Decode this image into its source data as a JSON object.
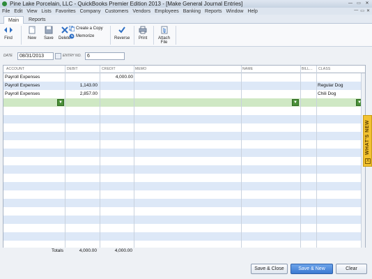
{
  "window": {
    "title": "Pine Lake Porcelain, LLC  - QuickBooks Premier Edition 2013 - [Make General Journal Entries]",
    "controls": [
      "—",
      "▭",
      "✕"
    ]
  },
  "menu": {
    "items": [
      "File",
      "Edit",
      "View",
      "Lists",
      "Favorites",
      "Company",
      "Customers",
      "Vendors",
      "Employees",
      "Banking",
      "Reports",
      "Window",
      "Help"
    ],
    "controls": [
      "—",
      "▭",
      "✕"
    ]
  },
  "tabs": [
    {
      "label": "Main",
      "active": true
    },
    {
      "label": "Reports",
      "active": false
    }
  ],
  "toolbar": {
    "find": "Find",
    "new": "New",
    "save": "Save",
    "delete": "Delete",
    "create_copy": "Create a Copy",
    "memorize": "Memorize",
    "reverse": "Reverse",
    "print": "Print",
    "attach_file_line1": "Attach",
    "attach_file_line2": "File"
  },
  "fields": {
    "date_label": "DATE",
    "date_value": "08/31/2013",
    "entry_no_label": "ENTRY NO.",
    "entry_no_value": "6"
  },
  "grid": {
    "headers": {
      "account": "ACCOUNT",
      "debit": "DEBIT",
      "credit": "CREDIT",
      "memo": "MEMO",
      "name": "NAME",
      "billable": "BILL...",
      "class": "CLASS"
    },
    "rows": [
      {
        "account": "Payroll Expenses",
        "debit": "",
        "credit": "4,000.00",
        "memo": "",
        "name": "",
        "class": ""
      },
      {
        "account": "Payroll Expenses",
        "debit": "1,143.00",
        "credit": "",
        "memo": "",
        "name": "",
        "class": "Regular Dog"
      },
      {
        "account": "Payroll Expenses",
        "debit": "2,857.00",
        "credit": "",
        "memo": "",
        "name": "",
        "class": "Chili Dog"
      }
    ]
  },
  "totals": {
    "label": "Totals",
    "debit": "4,000.00",
    "credit": "4,000.00"
  },
  "whats_new": {
    "label": "WHAT'S NEW",
    "close": "X"
  },
  "buttons": {
    "save_close": "Save & Close",
    "save_new": "Save & New",
    "clear": "Clear"
  },
  "colors": {
    "accent": "#3b79d1",
    "row_alt": "#dde8f7",
    "row_selected": "#cfe8c4",
    "whats_new": "#f2c230"
  }
}
